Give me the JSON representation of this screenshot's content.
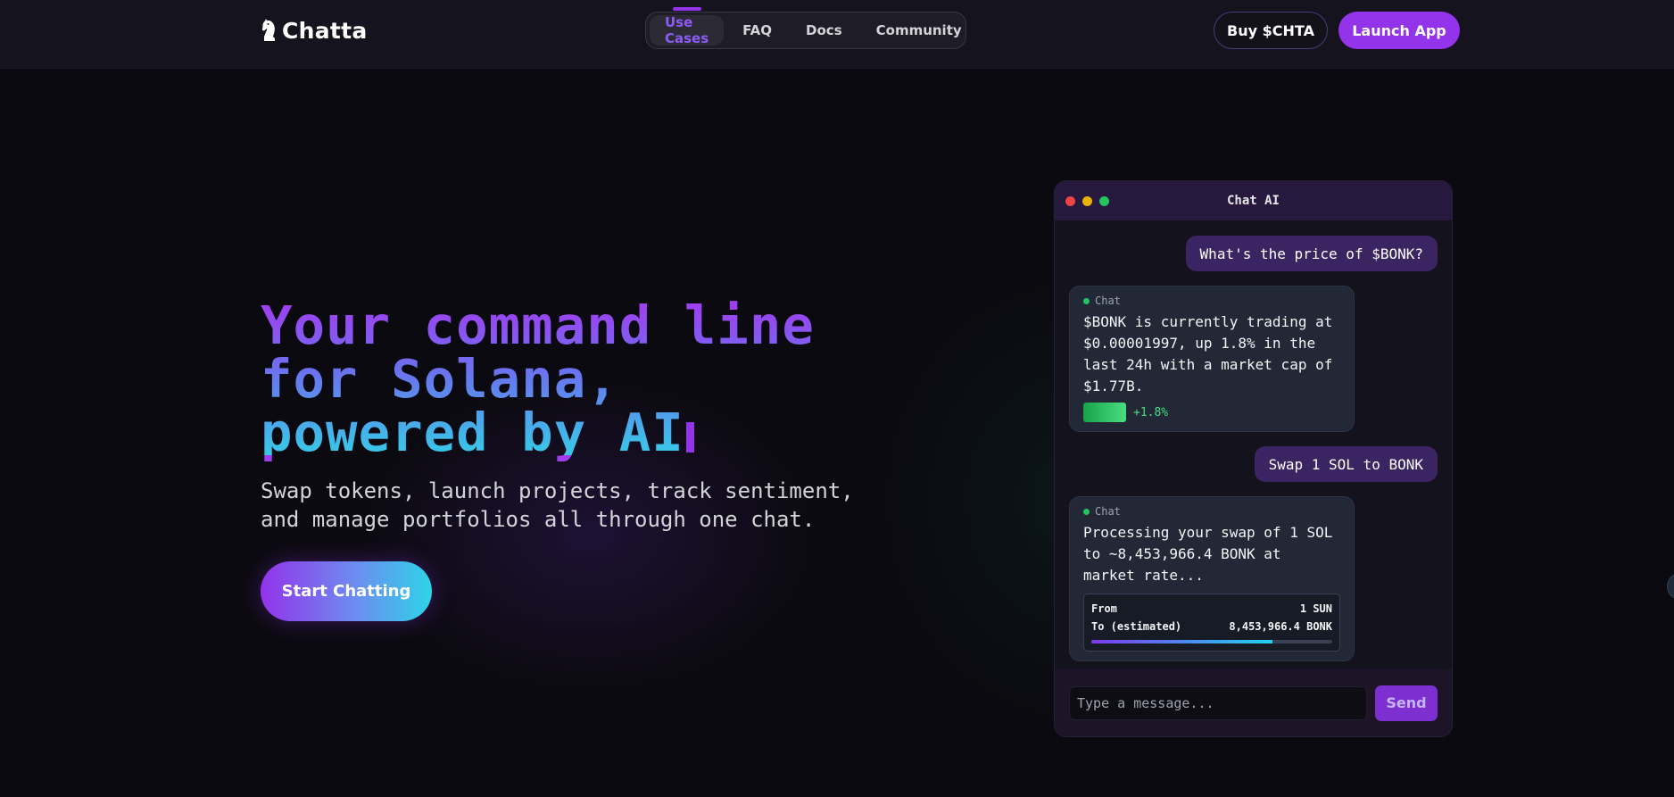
{
  "header": {
    "logo_text": "Chatta",
    "logo_icon": "chess-knight-icon",
    "nav": [
      {
        "label": "Use Cases",
        "active": true
      },
      {
        "label": "FAQ",
        "active": false
      },
      {
        "label": "Docs",
        "active": false
      },
      {
        "label": "Community",
        "active": false
      }
    ],
    "buy_label": "Buy $CHTA",
    "launch_label": "Launch App"
  },
  "hero": {
    "title_lines": [
      "Your command line",
      "for Solana,",
      "powered by AI"
    ],
    "subtitle": "Swap tokens, launch projects, track sentiment, and manage portfolios all through one chat.",
    "cta_label": "Start Chatting"
  },
  "chat": {
    "window_title": "Chat AI",
    "messages": [
      {
        "role": "user",
        "text": "What's the price of $BONK?"
      },
      {
        "role": "bot",
        "label": "Chat",
        "text": "$BONK is currently trading at $0.00001997, up 1.8% in the last 24h with a market cap of $1.77B.",
        "change": "+1.8%"
      },
      {
        "role": "user",
        "text": "Swap 1 SOL to BONK"
      },
      {
        "role": "bot",
        "label": "Chat",
        "text": "Processing your swap of 1 SOL to ~8,453,966.4 BONK at market rate...",
        "swap": {
          "from_label": "From",
          "from_value": "1 SUN",
          "to_label": "To (estimated)",
          "to_value": "8,453,966.4 BONK",
          "progress": 0.75
        }
      }
    ],
    "input_placeholder": "Type a message...",
    "send_label": "Send"
  },
  "colors": {
    "accent": "#9333ea",
    "cyan": "#2dd4e8",
    "positive": "#4ade80",
    "background": "#0b0a10"
  }
}
